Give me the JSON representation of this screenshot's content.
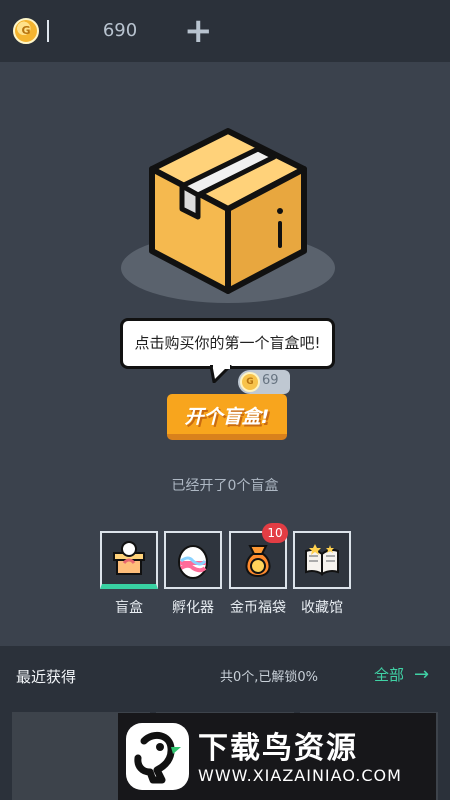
{
  "header": {
    "currency_icon": "gold-coin-icon",
    "coin_symbol": "G",
    "balance": "690",
    "add_icon": "plus-icon"
  },
  "hero": {
    "illustration": "blind-box-icon",
    "prompt": "点击购买你的第一个盲盒吧!",
    "price_coin_symbol": "G",
    "price": "69",
    "open_button_label": "开个盲盒!",
    "opened_text": "已经开了0个盲盒"
  },
  "navigation": [
    {
      "label": "盲盒",
      "icon": "gift-box-icon",
      "selected": true
    },
    {
      "label": "孵化器",
      "icon": "egg-icon",
      "selected": false
    },
    {
      "label": "金币福袋",
      "icon": "money-bag-icon",
      "selected": false,
      "badge": "10"
    },
    {
      "label": "收藏馆",
      "icon": "open-book-icon",
      "selected": false
    }
  ],
  "recent": {
    "title": "最近获得",
    "summary": "共0个,已解锁0%",
    "view_all": "全部",
    "arrow": "→"
  },
  "watermark": {
    "title": "下载鸟资源",
    "url": "WWW.XIAZAINIAO.COM"
  },
  "colors": {
    "accent": "#38d1a2",
    "button": "#f8a51d",
    "badge": "#e23d44"
  }
}
